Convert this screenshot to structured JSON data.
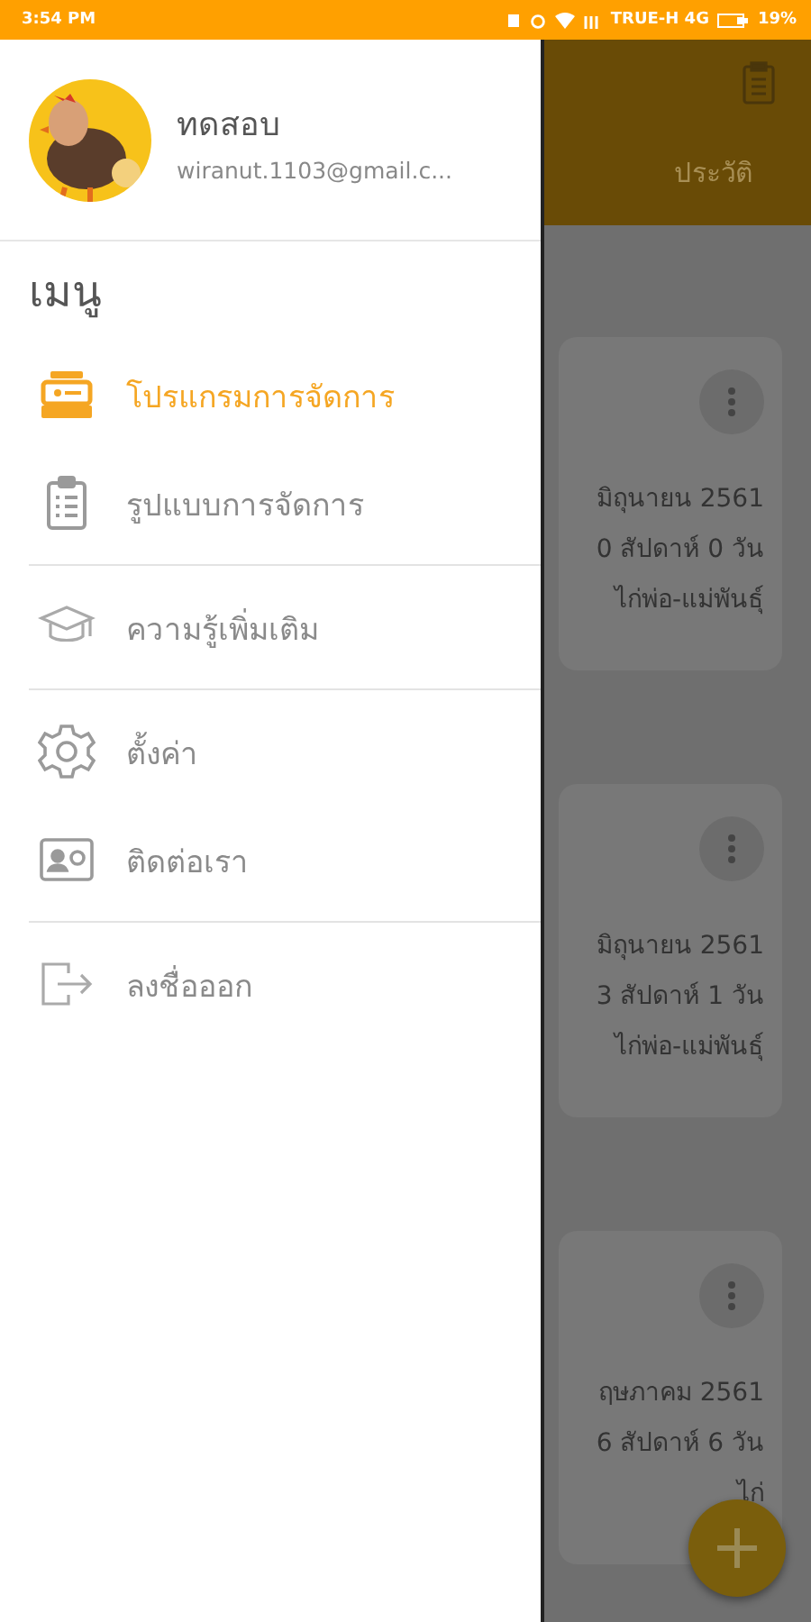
{
  "status_bar": {
    "time": "3:54 PM",
    "carrier": "TRUE-H 4G",
    "battery": "19%"
  },
  "drawer": {
    "user": {
      "name": "ทดสอบ",
      "email": "wiranut.1103@gmail.c..."
    },
    "menu_title": "เมนู",
    "sections": [
      {
        "items": [
          {
            "label": "โปรแกรมการจัดการ",
            "kind": "program",
            "selected": true
          },
          {
            "label": "รูปแบบการจัดการ",
            "kind": "clipboard",
            "selected": false
          }
        ]
      },
      {
        "items": [
          {
            "label": "ความรู้เพิ่มเติม",
            "kind": "cap",
            "selected": false
          }
        ]
      },
      {
        "items": [
          {
            "label": "ตั้งค่า",
            "kind": "gear",
            "selected": false
          },
          {
            "label": "ติดต่อเรา",
            "kind": "contact",
            "selected": false
          }
        ]
      },
      {
        "items": [
          {
            "label": "ลงชื่อออก",
            "kind": "logout",
            "selected": false
          }
        ]
      }
    ]
  },
  "background": {
    "tab_label": "ประวัติ",
    "cards": [
      {
        "lines": [
          "มิถุนายน 2561",
          "0 สัปดาห์ 0 วัน",
          "ไก่พ่อ-แม่พันธุ์"
        ]
      },
      {
        "lines": [
          "มิถุนายน 2561",
          "3 สัปดาห์ 1 วัน",
          "ไก่พ่อ-แม่พันธุ์"
        ]
      },
      {
        "lines": [
          "ฤษภาคม 2561",
          "6 สัปดาห์ 6 วัน",
          "ไก่"
        ]
      }
    ]
  }
}
